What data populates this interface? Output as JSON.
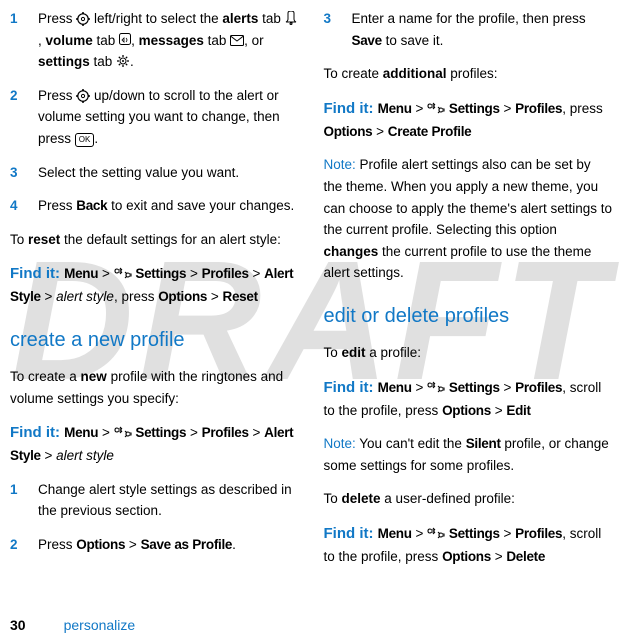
{
  "watermark": "DRAFT",
  "left": {
    "step1": {
      "num": "1",
      "a": "Press ",
      "nav": " left/right to select the ",
      "b": "alerts",
      "c": " tab ",
      "d": "volume",
      "e": " tab ",
      "f": "messages",
      "g": " tab ",
      "h": ", or ",
      "i": "settings",
      "j": " tab ",
      "end": "."
    },
    "step2": {
      "num": "2",
      "a": "Press ",
      "b": " up/down to scroll to the alert or volume setting you want to change, then press ",
      "ok": "OK",
      "end": "."
    },
    "step3": {
      "num": "3",
      "a": "Select the setting value you want."
    },
    "step4": {
      "num": "4",
      "a": "Press ",
      "back": "Back",
      "b": " to exit and save your changes."
    },
    "reset_para": {
      "a": "To ",
      "b": "reset",
      "c": " the default settings for an alert style:"
    },
    "findit_reset": {
      "label": "Find it: ",
      "path1": "Menu",
      "gt": " >  ",
      "path2": "Settings",
      "path3": "Profiles",
      "path4": "Alert Style",
      "alert": "alert style",
      "press": ", press ",
      "path5": "Options",
      "path6": "Reset"
    },
    "heading_create": "create a new profile",
    "create_para": {
      "a": "To create a ",
      "b": "new",
      "c": " profile with the ringtones and volume settings you specify:"
    },
    "findit_create": {
      "label": "Find it: ",
      "path1": "Menu",
      "path2": "Settings",
      "path3": "Profiles",
      "path4": "Alert Style",
      "alert": "alert style"
    },
    "cstep1": {
      "num": "1",
      "a": "Change alert style settings as described in the previous section."
    },
    "cstep2": {
      "num": "2",
      "a": "Press ",
      "opt": "Options",
      "gt": " > ",
      "save": "Save as Profile",
      "end": "."
    }
  },
  "right": {
    "step3": {
      "num": "3",
      "a": "Enter a name for the profile, then press ",
      "save": "Save",
      "b": " to save it."
    },
    "add_para": {
      "a": "To create ",
      "b": "additional",
      "c": " profiles:"
    },
    "findit_add": {
      "label": "Find it: ",
      "path1": "Menu",
      "path2": "Settings",
      "path3": "Profiles",
      "press": ", press ",
      "opt": "Options",
      "cp": "Create Profile"
    },
    "note": {
      "label": "Note: ",
      "a": "Profile alert settings also can be set by the theme. When you apply a new theme, you can choose to apply the theme's alert settings to the current profile. Selecting this option ",
      "b": "changes",
      "c": " the current profile to use the theme alert settings."
    },
    "heading_edit": "edit or delete profiles",
    "edit_para": {
      "a": "To ",
      "b": "edit",
      "c": " a profile:"
    },
    "findit_edit": {
      "label": "Find it: ",
      "path1": "Menu",
      "path2": "Settings",
      "path3": "Profiles",
      "scroll": ", scroll to the profile, press ",
      "opt": "Options",
      "edit": "Edit"
    },
    "note2": {
      "label": "Note: ",
      "a": "You can't edit the ",
      "silent": "Silent",
      "b": " profile, or change some settings for some profiles."
    },
    "del_para": {
      "a": "To ",
      "b": "delete",
      "c": " a user-defined profile:"
    },
    "findit_del": {
      "label": "Find it: ",
      "path1": "Menu",
      "path2": "Settings",
      "path3": "Profiles",
      "scroll": ", scroll to the profile, press ",
      "opt": "Options",
      "del": "Delete"
    }
  },
  "footer": {
    "page": "30",
    "section": "personalize"
  },
  "gt": " > "
}
